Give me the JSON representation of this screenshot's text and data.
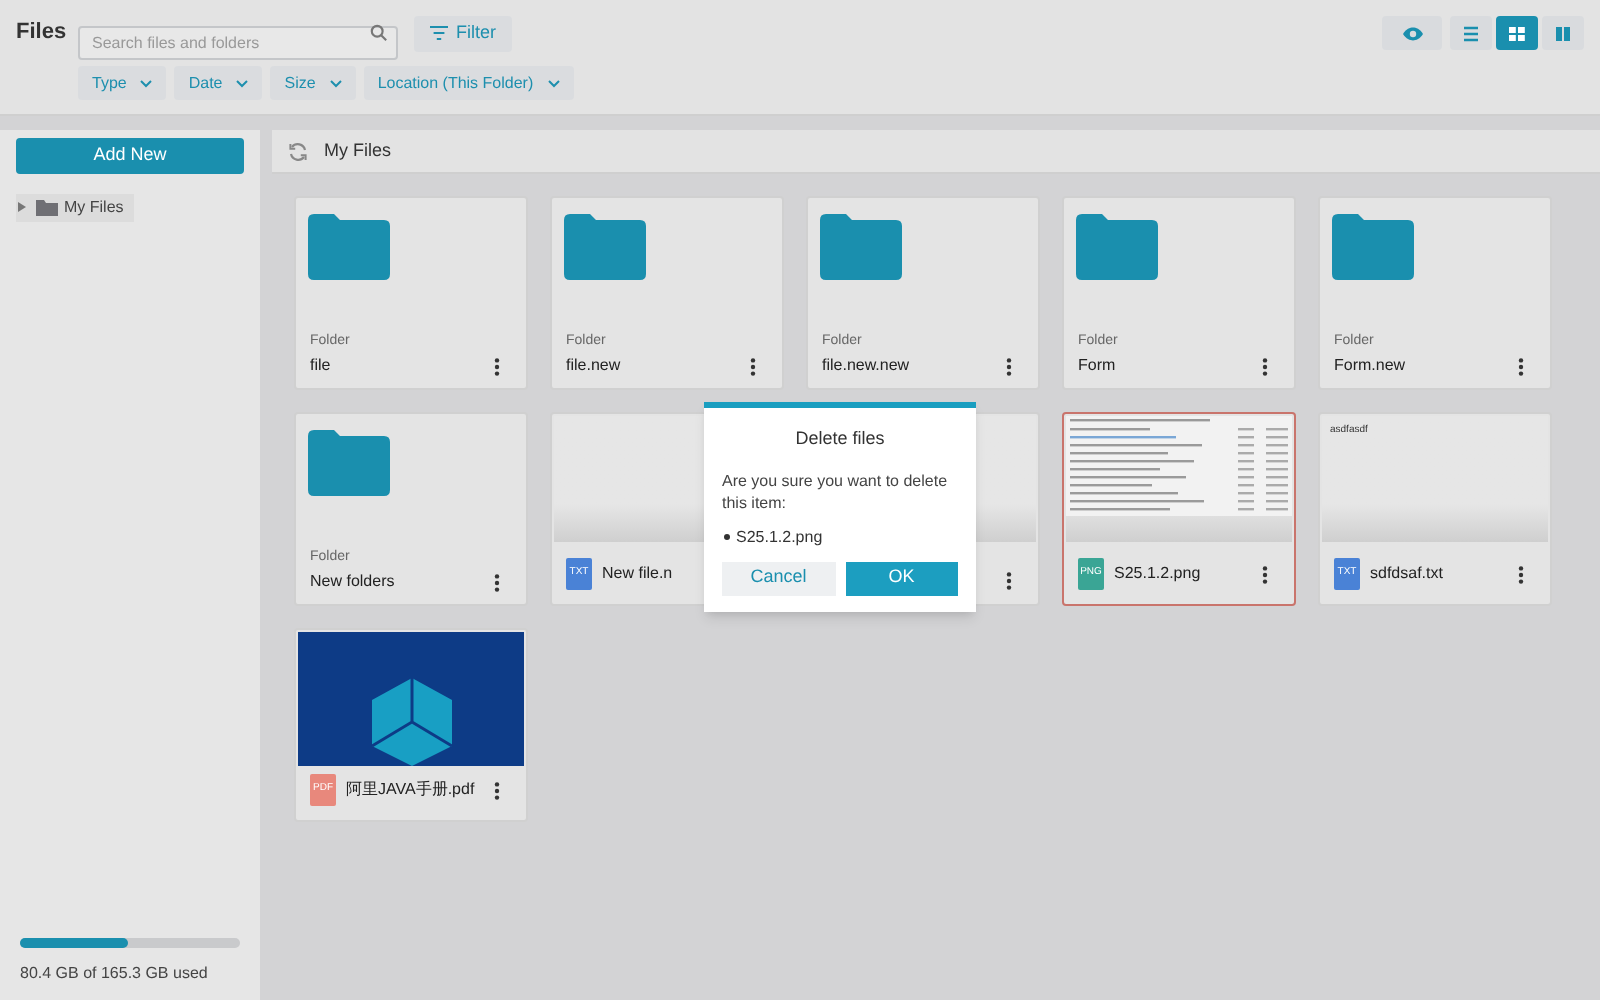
{
  "header": {
    "title": "Files",
    "search": {
      "placeholder": "Search files and folders"
    },
    "filter_button": "Filter",
    "filters": [
      "Type",
      "Date",
      "Size",
      "Location (This Folder)"
    ],
    "view_buttons": [
      {
        "kind": "preview",
        "selected": false
      },
      {
        "kind": "list",
        "selected": false
      },
      {
        "kind": "grid",
        "selected": true
      },
      {
        "kind": "columns",
        "selected": false
      }
    ]
  },
  "sidebar": {
    "add_button": "Add New",
    "tree": [
      {
        "label": "My Files",
        "expanded": false
      }
    ],
    "storage": {
      "level": 0.49,
      "text": "80.4 GB of 165.3 GB used"
    }
  },
  "breadcrumb": "My Files",
  "items": [
    {
      "kind": "folder",
      "type_label": "Folder",
      "name": "file",
      "selected": false
    },
    {
      "kind": "folder",
      "type_label": "Folder",
      "name": "file.new",
      "selected": false
    },
    {
      "kind": "folder",
      "type_label": "Folder",
      "name": "file.new.new",
      "selected": false
    },
    {
      "kind": "folder",
      "type_label": "Folder",
      "name": "Form",
      "selected": false
    },
    {
      "kind": "folder",
      "type_label": "Folder",
      "name": "Form.new",
      "selected": false
    },
    {
      "kind": "folder",
      "type_label": "Folder",
      "name": "New folders",
      "selected": false
    },
    {
      "kind": "file",
      "preview": {
        "kind": "blank"
      },
      "file_type": "TXT",
      "color": "#4a82d6",
      "name": "New file.n",
      "selected": false
    },
    {
      "kind": "file",
      "preview": {
        "kind": "blank"
      },
      "selected": false
    },
    {
      "kind": "file",
      "preview": {
        "kind": "screenshot"
      },
      "file_type": "PNG",
      "color": "#3aa595",
      "name": "S25.1.2.png",
      "selected": true
    },
    {
      "kind": "file",
      "preview": {
        "kind": "text",
        "text": "asdfasdf"
      },
      "file_type": "TXT",
      "color": "#4a82d6",
      "name": "sdfdsaf.txt",
      "selected": false
    },
    {
      "kind": "file",
      "preview": {
        "kind": "photo"
      },
      "file_type": "PDF",
      "color": "#e8887c",
      "name": "阿里JAVA手册.pdf",
      "selected": false
    }
  ],
  "dialog": {
    "title": "Delete files",
    "message": "Are you sure you want to delete this item:",
    "items": [
      "S25.1.2.png"
    ],
    "cancel": "Cancel",
    "ok": "OK"
  }
}
